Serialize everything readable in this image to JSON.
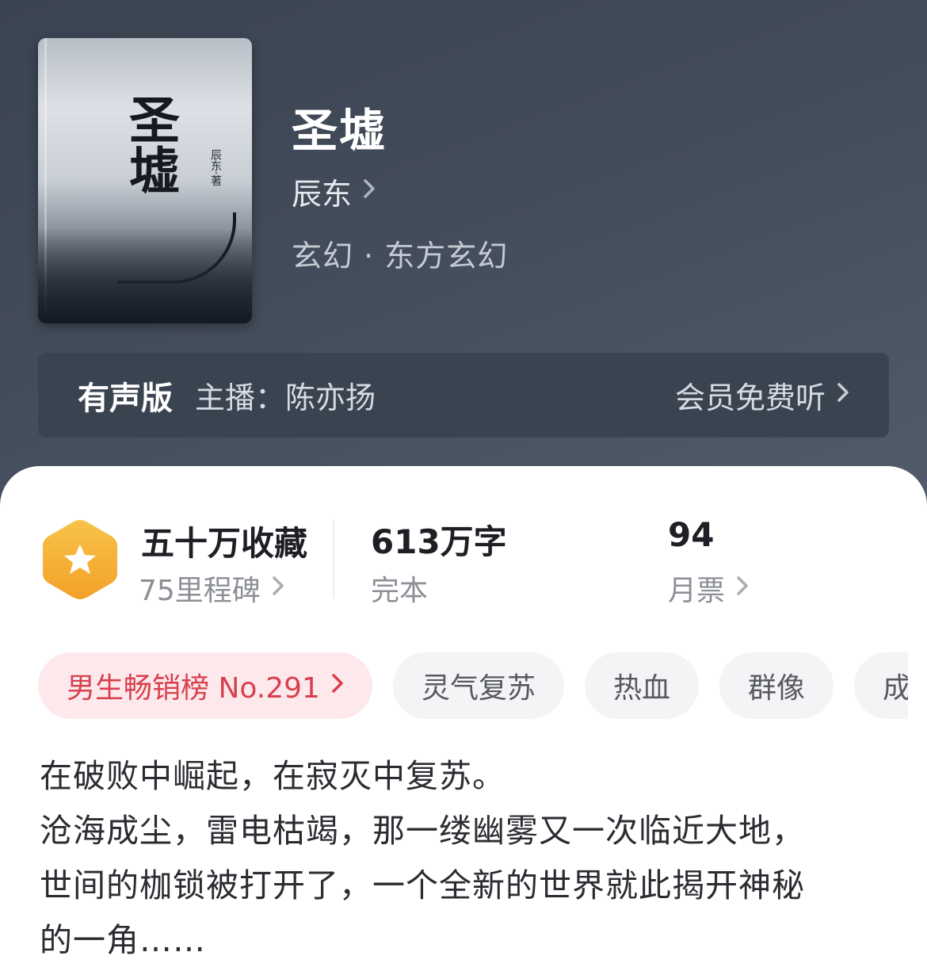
{
  "book": {
    "title": "圣墟",
    "author": "辰东",
    "genre": "玄幻 · 东方玄幻",
    "cover": {
      "title": "圣墟",
      "author": "辰东·著"
    }
  },
  "audio": {
    "label": "有声版",
    "host": "主播：陈亦扬",
    "action": "会员免费听"
  },
  "stats": {
    "favorites": {
      "title": "五十万收藏",
      "sub": "75里程碑"
    },
    "words": {
      "title": "613万字",
      "sub": "完本"
    },
    "tickets": {
      "title": "94",
      "sub": "月票"
    }
  },
  "tags": [
    "男生畅销榜 No.291",
    "灵气复苏",
    "热血",
    "群像",
    "成长"
  ],
  "synopsis": [
    "在破败中崛起，在寂灭中复苏。",
    "沧海成尘，雷电枯竭，那一缕幽雾又一次临近大地，",
    "世间的枷锁被打开了，一个全新的世界就此揭开神秘",
    "的一角……"
  ],
  "colors": {
    "hero_bg": "#434c5a",
    "badge": "#f5b030",
    "rank_text": "#d8404f",
    "rank_bg": "#fde9ec"
  },
  "icons": {
    "chevron": "chevron-right-icon",
    "badge": "star-badge-icon"
  }
}
